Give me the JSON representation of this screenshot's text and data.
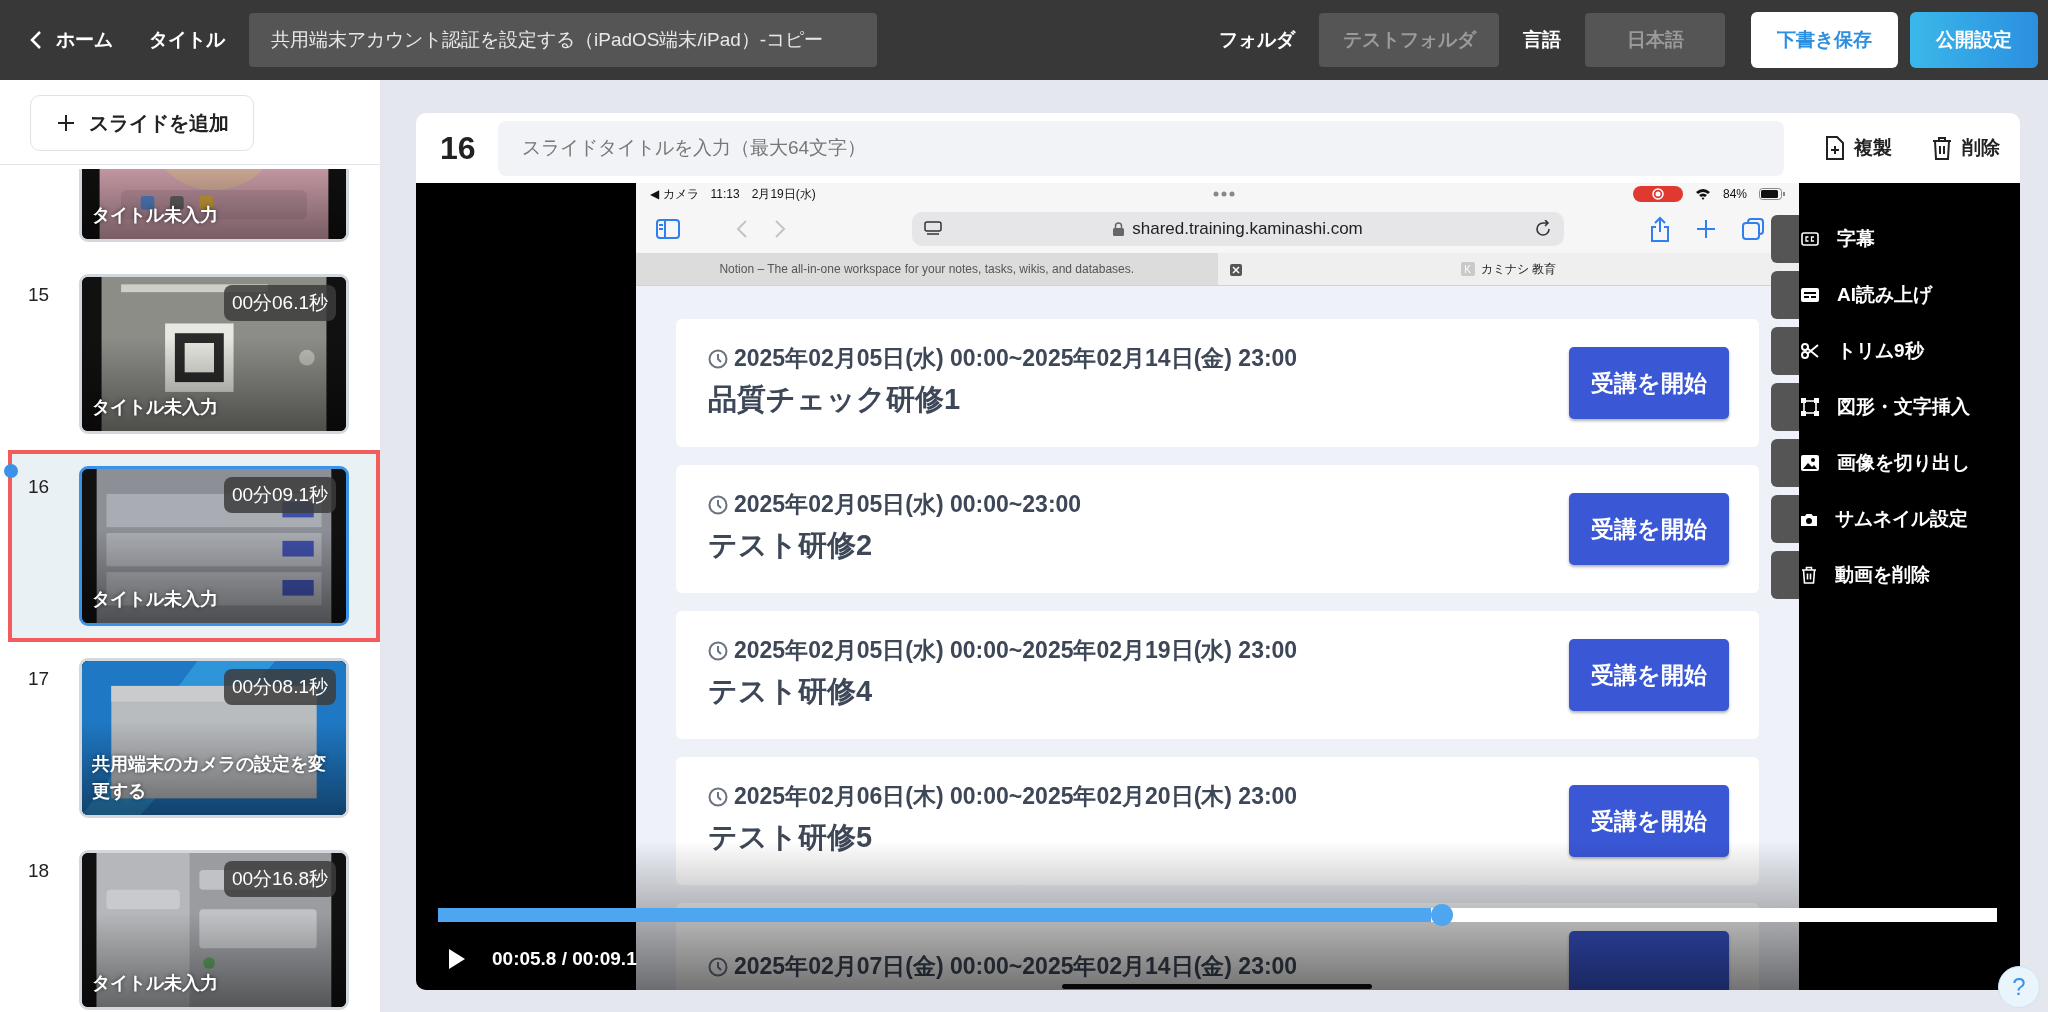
{
  "topbar": {
    "back": "ホーム",
    "title_label": "タイトル",
    "title_value": "共用端末アカウント認証を設定する（iPadOS端末/iPad）-コピー",
    "folder_label": "フォルダ",
    "folder_value": "テストフォルダ",
    "language_label": "言語",
    "language_value": "日本語",
    "buttons": [
      {
        "label": "下書き保存",
        "kind": "secondary"
      },
      {
        "label": "公開設定",
        "kind": "primary"
      }
    ]
  },
  "sidebar": {
    "add_button": "スライドを追加",
    "slides": [
      {
        "title": "タイトル未入力",
        "selected": false
      },
      {
        "number": "15",
        "duration": "00分06.1秒",
        "title": "タイトル未入力",
        "selected": false
      },
      {
        "number": "16",
        "duration": "00分09.1秒",
        "title": "タイトル未入力",
        "selected": true
      },
      {
        "number": "17",
        "duration": "00分08.1秒",
        "title": "共用端末のカメラの設定を変更する",
        "selected": false
      },
      {
        "number": "18",
        "duration": "00分16.8秒",
        "title": "タイトル未入力",
        "selected": false
      }
    ]
  },
  "editor": {
    "slide_number": "16",
    "title_placeholder": "スライドタイトルを入力（最大64文字）",
    "actions": [
      {
        "label": "複製",
        "kind": "duplicate"
      },
      {
        "label": "削除",
        "kind": "delete"
      }
    ],
    "video": {
      "screen": {
        "status": {
          "back_app": "◀ カメラ",
          "time": "11:13",
          "date": "2月19日(水)",
          "battery": "84%"
        },
        "url": "shared.training.kaminashi.com",
        "tabs": [
          {
            "label": "Notion – The all-in-one workspace for your notes, tasks, wikis, and databases.",
            "selected": false
          },
          {
            "favicon": "K",
            "label": "カミナシ 教育",
            "selected": true
          }
        ],
        "courses": [
          {
            "period": "2025年02月05日(水) 00:00~2025年02月14日(金) 23:00",
            "name": "品質チェック研修1",
            "button": "受講を開始"
          },
          {
            "period": "2025年02月05日(水) 00:00~23:00",
            "name": "テスト研修2",
            "button": "受講を開始"
          },
          {
            "period": "2025年02月05日(水) 00:00~2025年02月19日(水) 23:00",
            "name": "テスト研修4",
            "button": "受講を開始"
          },
          {
            "period": "2025年02月06日(木) 00:00~2025年02月20日(木) 23:00",
            "name": "テスト研修5",
            "button": "受講を開始"
          },
          {
            "period": "2025年02月07日(金) 00:00~2025年02月14日(金) 23:00"
          }
        ]
      },
      "menu": [
        {
          "label": "字幕",
          "kind": "captions"
        },
        {
          "label": "AI読み上げ",
          "kind": "voice"
        },
        {
          "label": "トリム9秒",
          "kind": "trim"
        },
        {
          "label": "図形・文字挿入",
          "kind": "shapes"
        },
        {
          "label": "画像を切り出し",
          "kind": "crop"
        },
        {
          "label": "サムネイル設定",
          "kind": "thumbnail"
        },
        {
          "label": "動画を削除",
          "kind": "delete"
        }
      ],
      "progress": {
        "level": 0.637
      },
      "time": "00:05.8 / 00:09.1"
    }
  },
  "help": "?"
}
